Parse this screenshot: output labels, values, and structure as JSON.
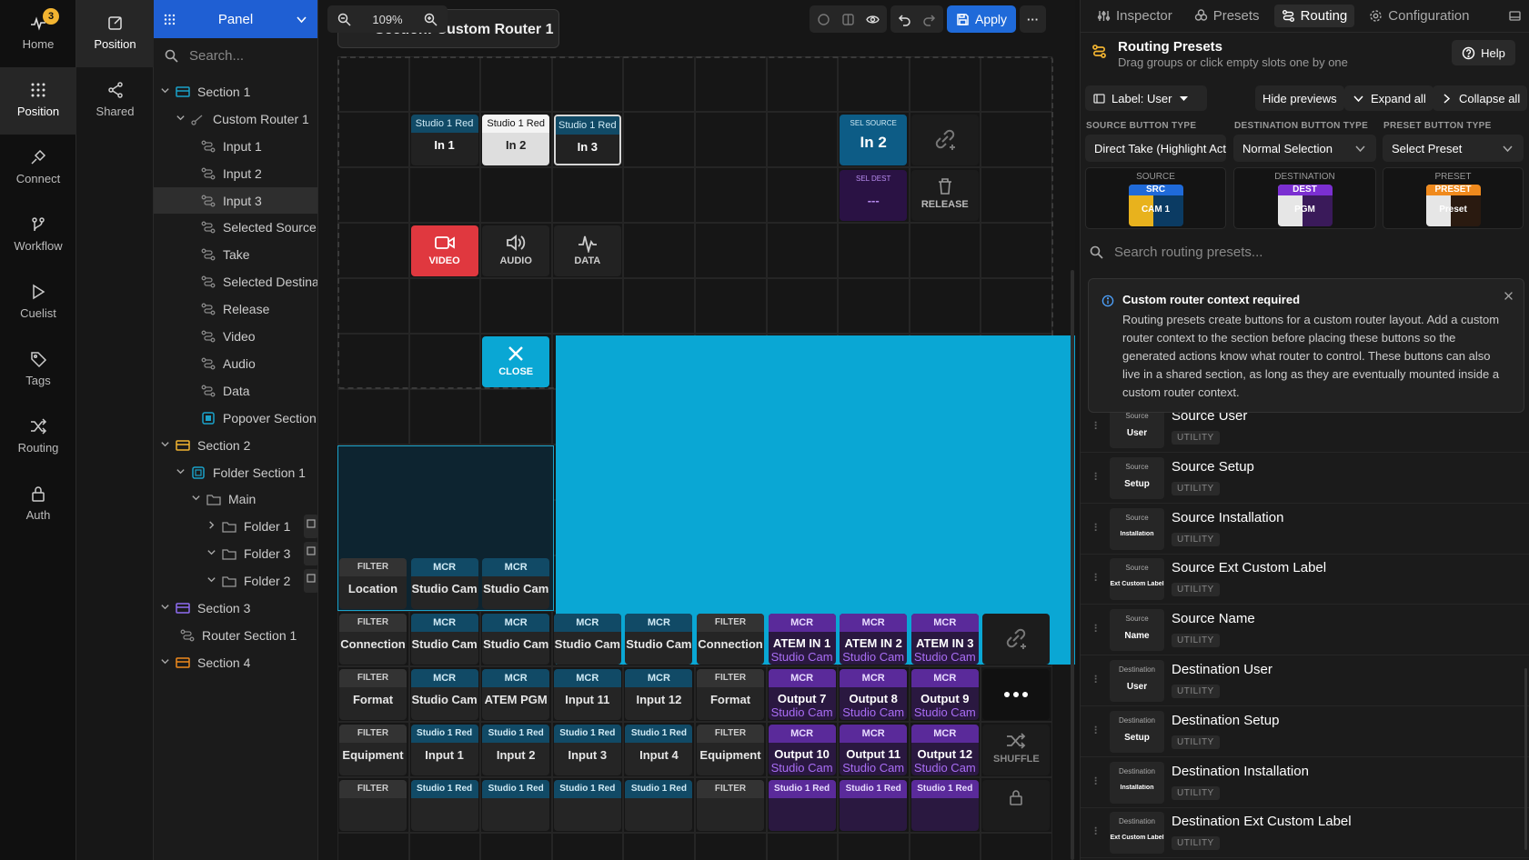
{
  "rail": [
    {
      "label": "Home",
      "icon": "home-icon"
    },
    {
      "label": "Position",
      "icon": "grid-dots-icon"
    },
    {
      "label": "Connect",
      "icon": "connect-icon"
    },
    {
      "label": "Workflow",
      "icon": "workflow-icon"
    },
    {
      "label": "Cuelist",
      "icon": "play-icon"
    },
    {
      "label": "Tags",
      "icon": "tag-icon"
    },
    {
      "label": "Routing",
      "icon": "shuffle-icon"
    },
    {
      "label": "Auth",
      "icon": "lock-icon"
    }
  ],
  "home_badge": "3",
  "rail2": [
    {
      "label": "Position",
      "icon": "edit-icon"
    },
    {
      "label": "Shared",
      "icon": "share-icon"
    }
  ],
  "panel": {
    "label": "Panel",
    "search_placeholder": "Search..."
  },
  "tree": [
    {
      "label": "Section 1",
      "depth": 0,
      "caret": "down",
      "icon": "section"
    },
    {
      "label": "Custom Router 1",
      "depth": 1,
      "caret": "down",
      "icon": "router"
    },
    {
      "label": "Input 1",
      "depth": 2,
      "icon": "route"
    },
    {
      "label": "Input 2",
      "depth": 2,
      "icon": "route"
    },
    {
      "label": "Input 3",
      "depth": 2,
      "icon": "route",
      "selected": true
    },
    {
      "label": "Selected Source",
      "depth": 2,
      "icon": "route"
    },
    {
      "label": "Take",
      "depth": 2,
      "icon": "route"
    },
    {
      "label": "Selected Destination",
      "depth": 2,
      "icon": "route"
    },
    {
      "label": "Release",
      "depth": 2,
      "icon": "route"
    },
    {
      "label": "Video",
      "depth": 2,
      "icon": "route"
    },
    {
      "label": "Audio",
      "depth": 2,
      "icon": "route"
    },
    {
      "label": "Data",
      "depth": 2,
      "icon": "route"
    },
    {
      "label": "Popover Section",
      "depth": 2,
      "icon": "popover"
    },
    {
      "label": "Section 2",
      "depth": 0,
      "caret": "down",
      "icon": "section2"
    },
    {
      "label": "Folder Section 1",
      "depth": 1,
      "caret": "down",
      "icon": "folder-section"
    },
    {
      "label": "Main",
      "depth": 2,
      "caret": "down",
      "icon": "folder"
    },
    {
      "label": "Folder 1",
      "depth": 3,
      "caret": "right",
      "icon": "folder"
    },
    {
      "label": "Folder 3",
      "depth": 3,
      "caret": "down",
      "icon": "folder"
    },
    {
      "label": "Folder 2",
      "depth": 3,
      "caret": "down",
      "icon": "folder"
    },
    {
      "label": "Section 3",
      "depth": 0,
      "caret": "down",
      "icon": "section3"
    },
    {
      "label": "Router Section 1",
      "depth": 1,
      "icon": "route"
    },
    {
      "label": "Section 4",
      "depth": 0,
      "caret": "down",
      "icon": "section4"
    }
  ],
  "toolbar": {
    "zoom": "109%",
    "apply": "Apply",
    "more": "···"
  },
  "section_title": "Section: Custom Router 1",
  "router": {
    "inputs": [
      {
        "top": "Studio 1 Red",
        "label": "In 1"
      },
      {
        "top": "Studio 1 Red",
        "label": "In 2"
      },
      {
        "top": "Studio 1 Red",
        "label": "In 3"
      }
    ],
    "sel_source": {
      "top": "SEL SOURCE",
      "label": "In 2"
    },
    "sel_dest": {
      "top": "SEL DEST",
      "label": "---"
    },
    "release": "RELEASE",
    "levels": [
      "VIDEO",
      "AUDIO",
      "DATA"
    ],
    "close": "CLOSE",
    "shuffle": "SHUFFLE"
  },
  "grid_rows": [
    {
      "row": 0,
      "cells": [
        {
          "col": 0,
          "kind": "filter",
          "t": "FILTER",
          "b": "Location"
        },
        {
          "col": 1,
          "kind": "mcr",
          "t": "MCR",
          "b": "Studio Cam"
        },
        {
          "col": 2,
          "kind": "mcr",
          "t": "MCR",
          "b": "Studio Cam"
        }
      ]
    },
    {
      "row": 1,
      "cells": [
        {
          "col": 0,
          "kind": "filter",
          "t": "FILTER",
          "b": "Connection"
        },
        {
          "col": 1,
          "kind": "mcr",
          "t": "MCR",
          "b": "Studio Cam"
        },
        {
          "col": 2,
          "kind": "mcr",
          "t": "MCR",
          "b": "Studio Cam"
        },
        {
          "col": 3,
          "kind": "mcr",
          "t": "MCR",
          "b": "Studio Cam"
        },
        {
          "col": 4,
          "kind": "mcr",
          "t": "MCR",
          "b": "Studio Cam"
        },
        {
          "col": 5,
          "kind": "filter",
          "t": "FILTER",
          "b": "Connection"
        },
        {
          "col": 6,
          "kind": "pur",
          "t": "MCR",
          "b": "ATEM IN 1",
          "s": "Studio Cam"
        },
        {
          "col": 7,
          "kind": "pur",
          "t": "MCR",
          "b": "ATEM IN 2",
          "s": "Studio Cam"
        },
        {
          "col": 8,
          "kind": "pur",
          "t": "MCR",
          "b": "ATEM IN 3",
          "s": "Studio Cam"
        }
      ]
    },
    {
      "row": 2,
      "cells": [
        {
          "col": 0,
          "kind": "filter",
          "t": "FILTER",
          "b": "Format"
        },
        {
          "col": 1,
          "kind": "mcr",
          "t": "MCR",
          "b": "Studio Cam"
        },
        {
          "col": 2,
          "kind": "mcr",
          "t": "MCR",
          "b": "ATEM PGM"
        },
        {
          "col": 3,
          "kind": "mcr",
          "t": "MCR",
          "b": "Input 11"
        },
        {
          "col": 4,
          "kind": "mcr",
          "t": "MCR",
          "b": "Input 12"
        },
        {
          "col": 5,
          "kind": "filter",
          "t": "FILTER",
          "b": "Format"
        },
        {
          "col": 6,
          "kind": "pur",
          "t": "MCR",
          "b": "Output 7",
          "s": "Studio Cam"
        },
        {
          "col": 7,
          "kind": "pur",
          "t": "MCR",
          "b": "Output 8",
          "s": "Studio Cam"
        },
        {
          "col": 8,
          "kind": "pur",
          "t": "MCR",
          "b": "Output 9",
          "s": "Studio Cam"
        }
      ]
    },
    {
      "row": 3,
      "cells": [
        {
          "col": 0,
          "kind": "filter",
          "t": "FILTER",
          "b": "Equipment"
        },
        {
          "col": 1,
          "kind": "mcr",
          "t": "Studio 1 Red",
          "b": "Input 1"
        },
        {
          "col": 2,
          "kind": "mcr",
          "t": "Studio 1 Red",
          "b": "Input 2"
        },
        {
          "col": 3,
          "kind": "mcr",
          "t": "Studio 1 Red",
          "b": "Input 3"
        },
        {
          "col": 4,
          "kind": "mcr",
          "t": "Studio 1 Red",
          "b": "Input 4"
        },
        {
          "col": 5,
          "kind": "filter",
          "t": "FILTER",
          "b": "Equipment"
        },
        {
          "col": 6,
          "kind": "pur",
          "t": "MCR",
          "b": "Output 10",
          "s": "Studio Cam"
        },
        {
          "col": 7,
          "kind": "pur",
          "t": "MCR",
          "b": "Output 11",
          "s": "Studio Cam"
        },
        {
          "col": 8,
          "kind": "pur",
          "t": "MCR",
          "b": "Output 12",
          "s": "Studio Cam"
        }
      ]
    },
    {
      "row": 4,
      "cells": [
        {
          "col": 0,
          "kind": "filter",
          "t": "FILTER",
          "b": ""
        },
        {
          "col": 1,
          "kind": "mcr",
          "t": "Studio 1 Red",
          "b": ""
        },
        {
          "col": 2,
          "kind": "mcr",
          "t": "Studio 1 Red",
          "b": ""
        },
        {
          "col": 3,
          "kind": "mcr",
          "t": "Studio 1 Red",
          "b": ""
        },
        {
          "col": 4,
          "kind": "mcr",
          "t": "Studio 1 Red",
          "b": ""
        },
        {
          "col": 5,
          "kind": "filter",
          "t": "FILTER",
          "b": ""
        },
        {
          "col": 6,
          "kind": "pur",
          "t": "Studio 1 Red",
          "b": ""
        },
        {
          "col": 7,
          "kind": "pur",
          "t": "Studio 1 Red",
          "b": ""
        },
        {
          "col": 8,
          "kind": "pur",
          "t": "Studio 1 Red",
          "b": ""
        }
      ]
    }
  ],
  "right": {
    "tabs": [
      {
        "label": "Inspector",
        "icon": "sliders-icon"
      },
      {
        "label": "Presets",
        "icon": "presets-icon"
      },
      {
        "label": "Routing",
        "icon": "routing-icon",
        "active": true
      },
      {
        "label": "Configuration",
        "icon": "gear-icon"
      }
    ],
    "title": "Routing Presets",
    "subtitle": "Drag groups or click empty slots one by one",
    "help": "Help",
    "label_select": "Label: User",
    "hide_previews": "Hide previews",
    "expand_all": "Expand all",
    "collapse_all": "Collapse all",
    "type_labels": [
      "SOURCE BUTTON TYPE",
      "DESTINATION BUTTON TYPE",
      "PRESET BUTTON TYPE"
    ],
    "type_values": [
      "Direct Take (Highlight Active)",
      "Normal Selection",
      "Select Preset"
    ],
    "previews": [
      {
        "label": "SOURCE",
        "top": "SRC",
        "bottom": "CAM 1"
      },
      {
        "label": "DESTINATION",
        "top": "DEST",
        "bottom": "PGM"
      },
      {
        "label": "PRESET",
        "top": "PRESET",
        "bottom": "Preset"
      }
    ],
    "search_placeholder": "Search routing presets...",
    "alert_title": "Custom router context required",
    "alert_body": "Routing presets create buttons for a custom router layout. Add a custom router context to the section before placing these buttons so the generated actions know what router to control. These buttons can also live in a shared section, as long as they are eventually mounted inside a custom router context.",
    "items": [
      {
        "name": "Source User",
        "thumb_top": "Source",
        "thumb": "User",
        "tag": "UTILITY"
      },
      {
        "name": "Source Setup",
        "thumb_top": "Source",
        "thumb": "Setup",
        "tag": "UTILITY"
      },
      {
        "name": "Source Installation",
        "thumb_top": "Source",
        "thumb": "Installation",
        "tag": "UTILITY"
      },
      {
        "name": "Source Ext Custom Label",
        "thumb_top": "Source",
        "thumb": "Ext Custom Label",
        "tag": "UTILITY"
      },
      {
        "name": "Source Name",
        "thumb_top": "Source",
        "thumb": "Name",
        "tag": "UTILITY"
      },
      {
        "name": "Destination User",
        "thumb_top": "Destination",
        "thumb": "User",
        "tag": "UTILITY"
      },
      {
        "name": "Destination Setup",
        "thumb_top": "Destination",
        "thumb": "Setup",
        "tag": "UTILITY"
      },
      {
        "name": "Destination Installation",
        "thumb_top": "Destination",
        "thumb": "Installation",
        "tag": "UTILITY"
      },
      {
        "name": "Destination Ext Custom Label",
        "thumb_top": "Destination",
        "thumb": "Ext Custom Label",
        "tag": "UTILITY"
      }
    ]
  },
  "colors": {
    "accent": "#1f6ad9",
    "cyan": "#0aa7d4",
    "red": "#e0383f",
    "purple": "#5a2a9a"
  }
}
